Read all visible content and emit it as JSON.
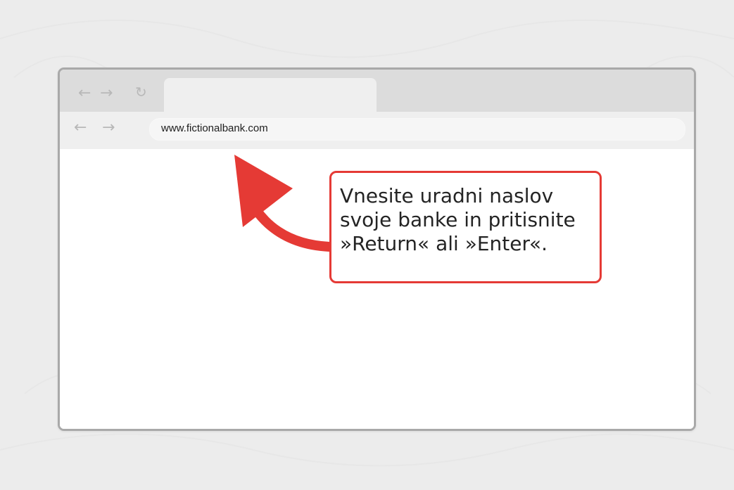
{
  "browser": {
    "url": "www.fictionalbank.com"
  },
  "icons": {
    "tab_back": "←",
    "tab_forward": "→",
    "tab_reload": "↻",
    "toolbar_back": "←",
    "toolbar_forward": "→"
  },
  "callout": {
    "lines": [
      "Vnesite uradni naslov",
      "svoje banke in pritisnite",
      "»Return« ali »Enter«."
    ]
  },
  "colors": {
    "background": "#ececec",
    "window_border": "#a9a9a9",
    "tab_strip": "#dcdcdc",
    "toolbar": "#efefef",
    "accent_red": "#e53a35"
  }
}
